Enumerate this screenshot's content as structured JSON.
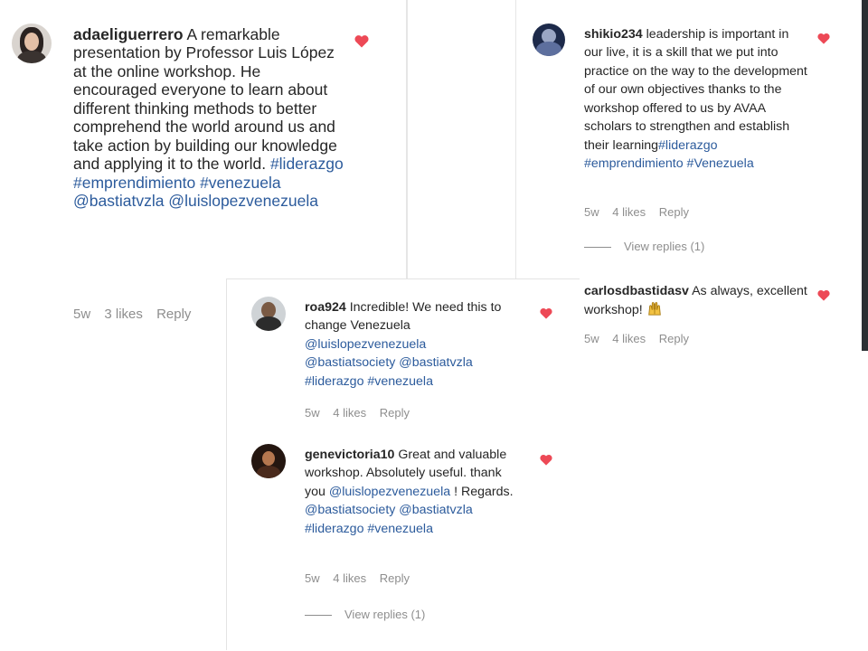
{
  "comments": {
    "adaeli": {
      "username": "adaeliguerrero",
      "text": "A remarkable presentation by Professor Luis López at the online workshop. He encouraged everyone to learn about different thinking methods to better comprehend the world around us and take action by building our knowledge and applying it to the world.",
      "tags": "#liderazgo #emprendimiento #venezuela @bastiatvzla @luislopezvenezuela",
      "time": "5w",
      "likes": "3 likes",
      "reply": "Reply",
      "liked": true
    },
    "shikio": {
      "username": "shikio234",
      "text": "leadership is important in our live, it is a skill that we put into practice on the way to the development of our own objectives thanks to the workshop offered to us by AVAA scholars to strengthen and establish their learning",
      "tags": "#liderazgo #emprendimiento #Venezuela",
      "time": "5w",
      "likes": "4 likes",
      "reply": "Reply",
      "view_replies": "View replies (1)",
      "liked": true
    },
    "carlos": {
      "username": "carlosdbastidasv",
      "text": "As always, excellent workshop!",
      "emoji": "raising-hands-emoji",
      "time": "5w",
      "likes": "4 likes",
      "reply": "Reply",
      "liked": true
    },
    "roa": {
      "username": "roa924",
      "text": "Incredible! We need this to change Venezuela",
      "tags": "@luislopezvenezuela @bastiatsociety @bastiatvzla #liderazgo #venezuela",
      "time": "5w",
      "likes": "4 likes",
      "reply": "Reply",
      "liked": true
    },
    "gene": {
      "username": "genevictoria10",
      "text": "Great and valuable workshop. Absolutely useful. thank you",
      "mention": "@luislopezvenezuela",
      "text_after": "! Regards.",
      "tags": "@bastiatsociety @bastiatvzla #liderazgo #venezuela",
      "time": "5w",
      "likes": "4 likes",
      "reply": "Reply",
      "view_replies": "View replies (1)",
      "liked": true
    }
  },
  "colors": {
    "heart": "#ed4956",
    "link": "#2c5b9c",
    "meta": "#8e8e8e",
    "text": "#262626"
  }
}
